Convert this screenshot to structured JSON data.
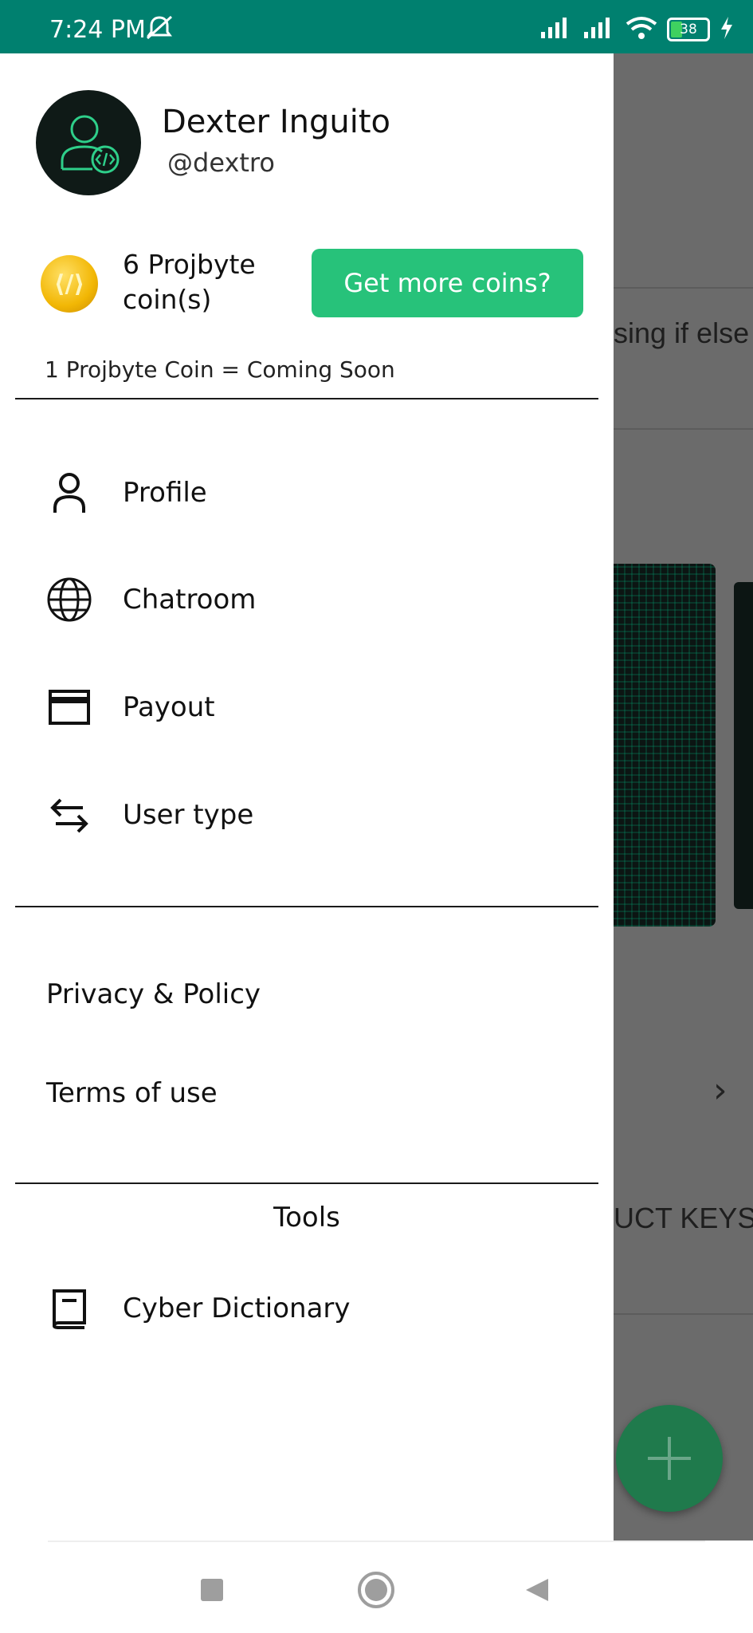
{
  "status_bar": {
    "time": "7:24 PM",
    "battery": "38"
  },
  "background": {
    "snippet_text": "sing if else",
    "product_keys_text": "UCT KEYS"
  },
  "drawer": {
    "user": {
      "name": "Dexter Inguito",
      "handle": "@dextro"
    },
    "coins": {
      "count_text": "6 Projbyte coin(s)",
      "button_label": "Get more coins?",
      "rate_text": "1 Projbyte Coin = Coming Soon"
    },
    "menu": [
      {
        "label": "Profile",
        "icon": "person-icon"
      },
      {
        "label": "Chatroom",
        "icon": "globe-icon"
      },
      {
        "label": "Payout",
        "icon": "card-icon"
      },
      {
        "label": "User type",
        "icon": "swap-arrows-icon"
      }
    ],
    "links": [
      {
        "label": "Privacy & Policy"
      },
      {
        "label": "Terms of use"
      }
    ],
    "tools": {
      "title": "Tools",
      "items": [
        {
          "label": "Cyber Dictionary",
          "icon": "book-icon"
        }
      ]
    }
  },
  "colors": {
    "status_bar": "#00806f",
    "accent_green": "#27c27a",
    "scrim": "#6b6b6b"
  }
}
